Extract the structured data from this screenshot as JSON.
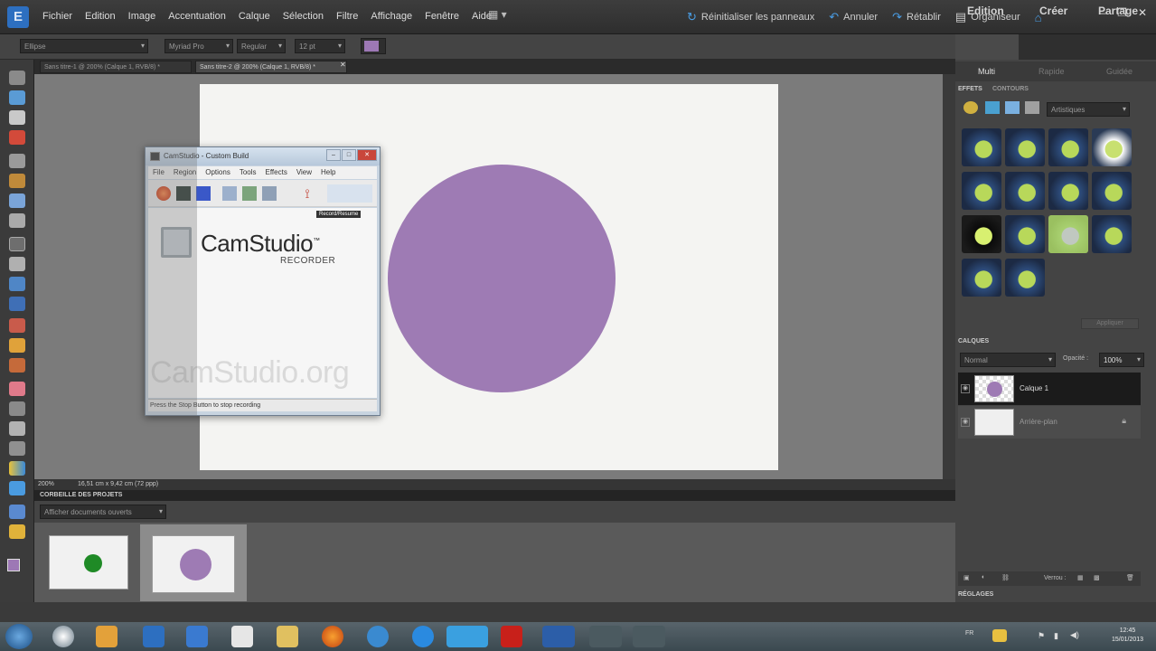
{
  "menu": [
    "Fichier",
    "Edition",
    "Image",
    "Accentuation",
    "Calque",
    "Sélection",
    "Filtre",
    "Affichage",
    "Fenêtre",
    "Aide"
  ],
  "topbar_actions": {
    "reset": "Réinitialiser les panneaux",
    "undo": "Annuler",
    "redo": "Rétablir",
    "organizer": "Organiseur"
  },
  "options": {
    "shape": "Ellipse",
    "font": "Myriad Pro",
    "style": "Regular",
    "size": "12 pt",
    "color": "#9d78b5"
  },
  "doc_tabs": [
    {
      "label": "Sans titre-1 @ 200% (Calque 1, RVB/8) *",
      "active": false
    },
    {
      "label": "Sans titre-2 @ 200% (Calque 1, RVB/8) *",
      "active": true
    }
  ],
  "status": {
    "zoom": "200%",
    "size": "16,51 cm x 9,42 cm (72 ppp)"
  },
  "camstudio": {
    "title": "CamStudio - Custom Build",
    "menu": [
      "File",
      "Region",
      "Options",
      "Tools",
      "Effects",
      "View",
      "Help"
    ],
    "tooltip": "Record/Resume",
    "logo": "CamStudio",
    "tm": "™",
    "subtitle": "RECORDER",
    "watermark": "CamStudio.org",
    "status": "Press the Stop Button to stop recording"
  },
  "circle_color": "#9e7bb4",
  "project_bin": {
    "title": "CORBEILLE DES PROJETS",
    "dropdown": "Afficher documents ouverts",
    "thumbs": [
      {
        "dot_color": "#1f8a26"
      },
      {
        "dot_color": "#9e7bb4"
      }
    ]
  },
  "right_panel": {
    "tabs": [
      "Edition",
      "Créer",
      "Partage"
    ],
    "subtabs": [
      "Multi",
      "Rapide",
      "Guidée"
    ],
    "effects_title": "EFFETS",
    "contours_title": "CONTOURS",
    "effects_dropdown": "Artistiques",
    "apply": "Appliquer",
    "layers_title": "CALQUES",
    "blend": "Normal",
    "opacity_label": "Opacité :",
    "opacity": "100%",
    "layers": [
      {
        "name": "Calque 1",
        "selected": true
      },
      {
        "name": "Arrière-plan",
        "selected": false
      }
    ],
    "lock_label": "Verrou :",
    "adjust_title": "RÉGLAGES"
  },
  "tray": {
    "lang": "FR",
    "time": "12:45",
    "date": "15/01/2013"
  }
}
